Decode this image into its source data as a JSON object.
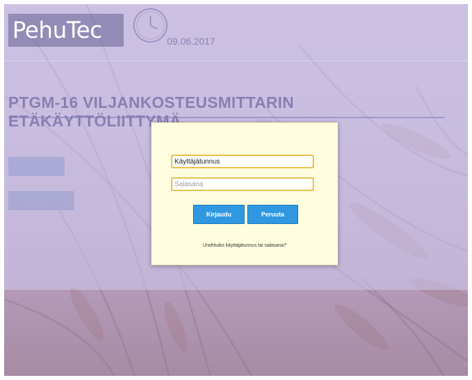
{
  "header": {
    "logo_text": "PehuTec",
    "date": "09.06.2017"
  },
  "page_title": "PTGM-16 VILJANKOSTEUSMITTARIN ETÄKÄYTTÖLIITTYMÄ",
  "login_dialog": {
    "username_value": "Käyttäjätunnus",
    "password_placeholder": "Salasana",
    "login_label": "Kirjaudu",
    "cancel_label": "Peruuta",
    "forgot_link": "Unohtuiko käyttäjätunnus tai salasana?"
  },
  "colors": {
    "accent_blue": "#2f98e0",
    "dialog_background": "#fffde0",
    "field_border": "#e8c14a"
  },
  "icons": [
    "clock-icon"
  ]
}
